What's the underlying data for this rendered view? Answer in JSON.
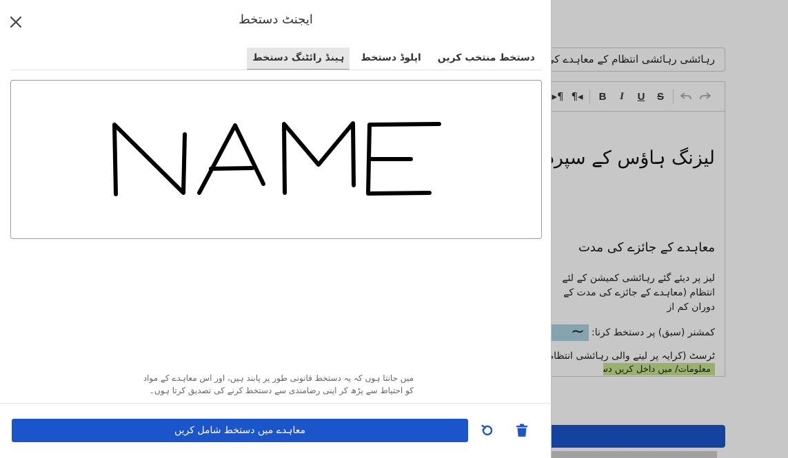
{
  "background": {
    "title_field_value": "رہائشی رہائشی انتظام کے معاہدے کی کاپی",
    "editor": {
      "toolbar": [
        "redo",
        "undo",
        "strikethrough",
        "underline",
        "italic",
        "bold",
        "ltr",
        "rtl"
      ],
      "toolbar_labels": {
        "bold": "B",
        "italic": "I",
        "underline": "U",
        "strike": "S",
        "ltr": "¶◂",
        "rtl": "▸¶"
      },
      "heading": "لیزنگ ہاؤس کے سپرد",
      "subheading": "معاہدے کے جائزے کی مدت",
      "paragraph": "لیز پر دیئے گئے رہائشی کمیشن کے لئے انتظام (معاہدے کے جائزے کی مدت کے دوران کم از",
      "commissioner_line": "کمشنر (سبق) پر دستخط کرنا:",
      "trust_line": "ٹرسٹ (کرایہ پر لینے والی رہائشی انتظامیہ",
      "highlight_text": "معلومات/ میں داخل کریں دستخط کریں"
    },
    "accent_color": "#1a55cc"
  },
  "modal": {
    "title": "ایجنٹ دستخط",
    "close_icon": "close-icon",
    "tabs": [
      {
        "label": "ہینڈ رائٹنگ دستخط",
        "active": true
      },
      {
        "label": "اپلوڈ دستخط",
        "active": false
      },
      {
        "label": "دستخط منتخب کریں",
        "active": false
      }
    ],
    "signature_text_drawn": "NAME",
    "disclaimer": "میں جانتا ہوں کہ یہ دستخط قانونی طور پر پابند ہیں، اور اس معاہدے کے مواد کو احتیاط سے پڑھ کر اپنی رضامندی سے دستخط کرنے کی تصدیق کرتا ہوں۔",
    "add_button_label": "معاہدے میں دستخط شامل کریں",
    "undo_icon": "undo-icon",
    "delete_icon": "trash-icon",
    "primary_color": "#1a55cc"
  }
}
